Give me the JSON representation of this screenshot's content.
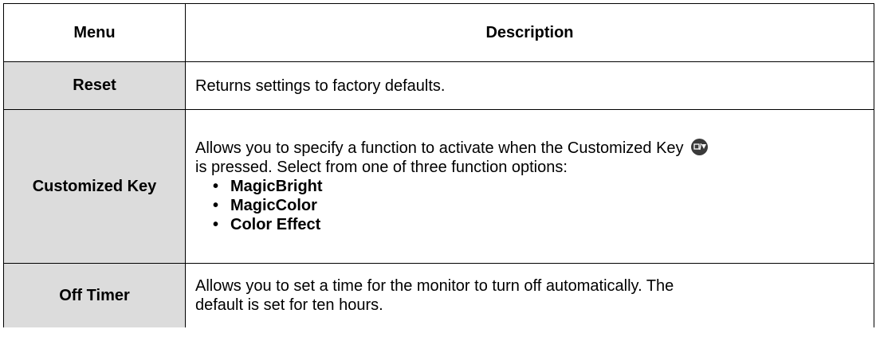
{
  "header": {
    "menu": "Menu",
    "description": "Description"
  },
  "rows": [
    {
      "menu": "Reset",
      "description": "Returns settings to factory defaults."
    },
    {
      "menu": "Customized Key",
      "description_line1": "Allows you to specify a function to activate when the Customized Key",
      "description_line2": "is pressed.  Select from one of three function options:",
      "key_icon": "customized-key-icon",
      "options": [
        "MagicBright",
        "MagicColor",
        "Color Effect"
      ]
    },
    {
      "menu": "Off Timer",
      "description_line1": "Allows you to set a time for the monitor to turn off automatically.  The",
      "description_line2": "default is set for ten hours."
    }
  ],
  "colors": {
    "menu_cell_bg": "#dcdcdc",
    "border": "#000000"
  }
}
